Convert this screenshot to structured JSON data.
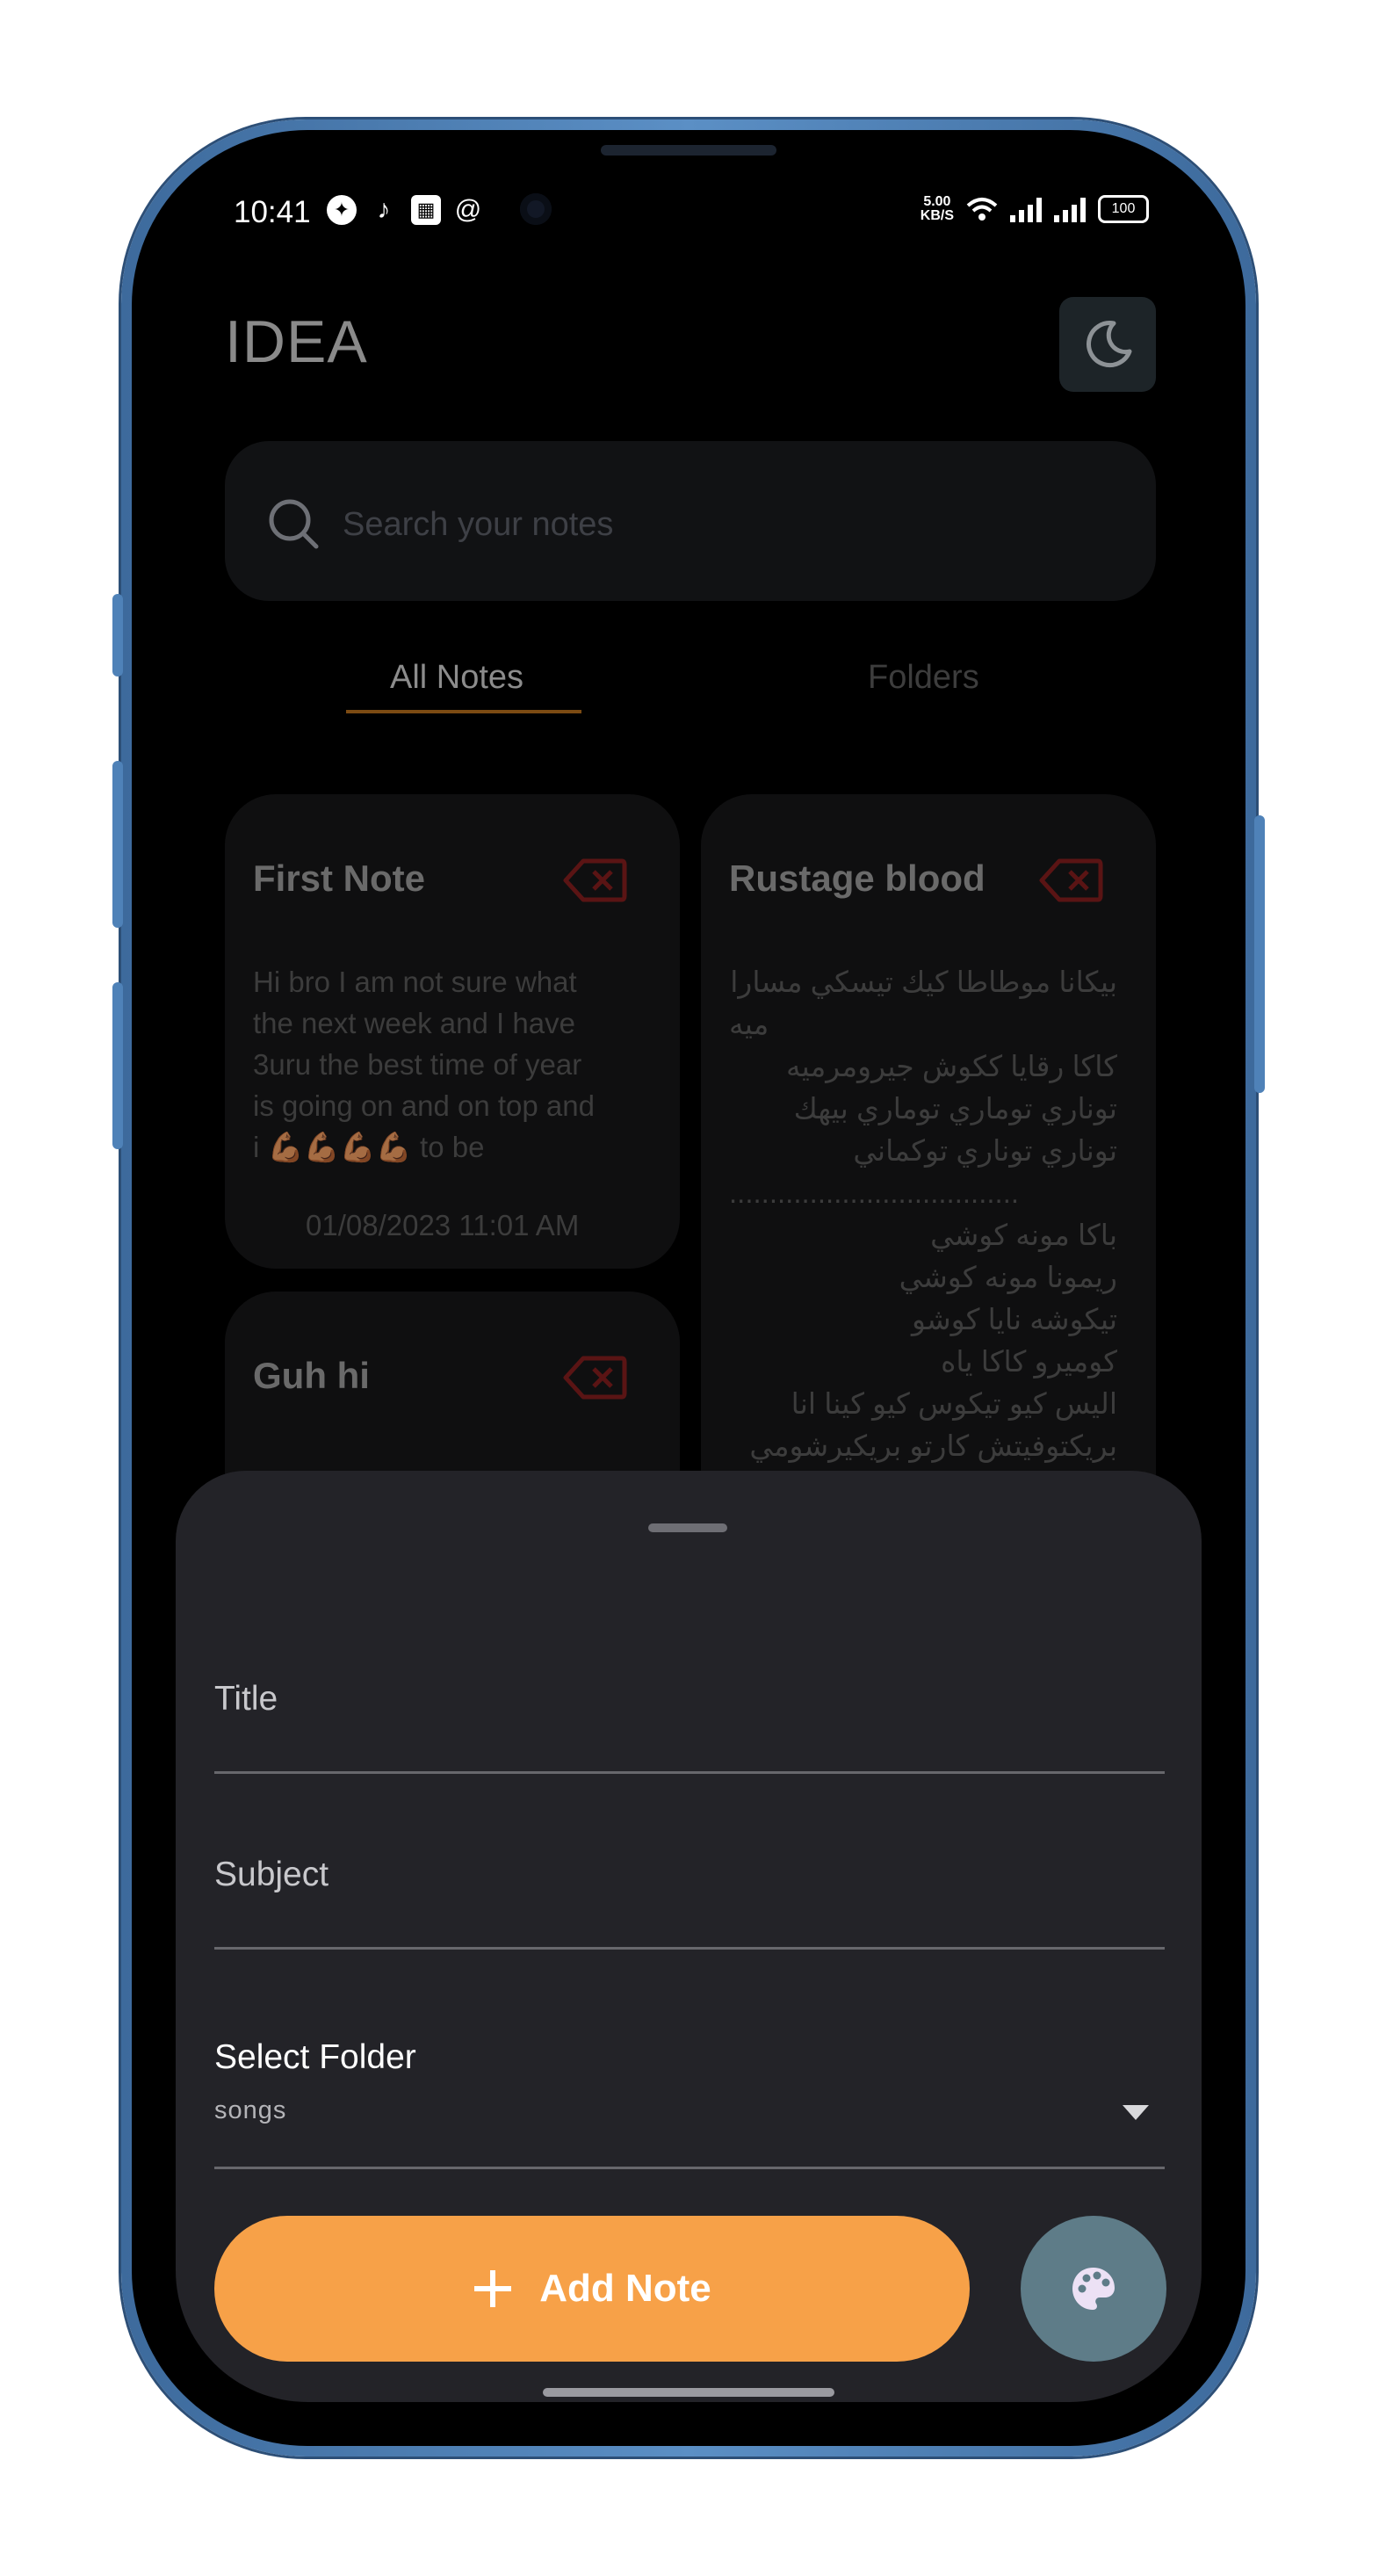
{
  "status_bar": {
    "time": "10:41",
    "speed_top": "5.00",
    "speed_bottom": "KB/S",
    "battery": "100"
  },
  "header": {
    "app_title": "IDEA",
    "theme_icon": "moon-icon"
  },
  "search": {
    "placeholder": "Search your notes",
    "icon": "search-icon"
  },
  "tabs": [
    {
      "label": "All Notes",
      "selected": true
    },
    {
      "label": "Folders",
      "selected": false
    }
  ],
  "notes": [
    {
      "title": "First Note",
      "body": [
        "Hi bro I am not sure what",
        "the next week and I have",
        "3uru the best time of year",
        "is going on and on top and",
        "i 💪🏾💪🏾💪🏾💪🏾 to be"
      ],
      "date": "01/08/2023 11:01 AM"
    },
    {
      "title": "Rustage blood",
      "body": [
        "بيكانا موطاطا كيك تيسكي مسارا",
        "ميه",
        "كاكا رقايا ككوش جيرومرميه",
        "توناري توماري توماري بيهك",
        "توناري توناري توكماني",
        "....................................",
        "باكا مونه كوشي",
        "ريمونا مونه كوشي",
        "تيكوشه نايا كوشو",
        "كوميرو كاكا ياه",
        "اليس كيو تيكوس كيو كينا انا",
        "بريكتوفيتش كارتو بريكيرشومي"
      ],
      "date": ""
    },
    {
      "title": "Guh hi",
      "body": [],
      "date": ""
    }
  ],
  "sheet": {
    "title_label": "Title",
    "subject_label": "Subject",
    "folder_label": "Select Folder",
    "folder_value": "songs",
    "add_button_label": "Add Note",
    "palette_icon": "palette-icon"
  },
  "colors": {
    "accent": "#f7a148",
    "sheet_bg": "#232328",
    "palette_button": "#5e7c88",
    "delete_icon": "#5a1414"
  }
}
